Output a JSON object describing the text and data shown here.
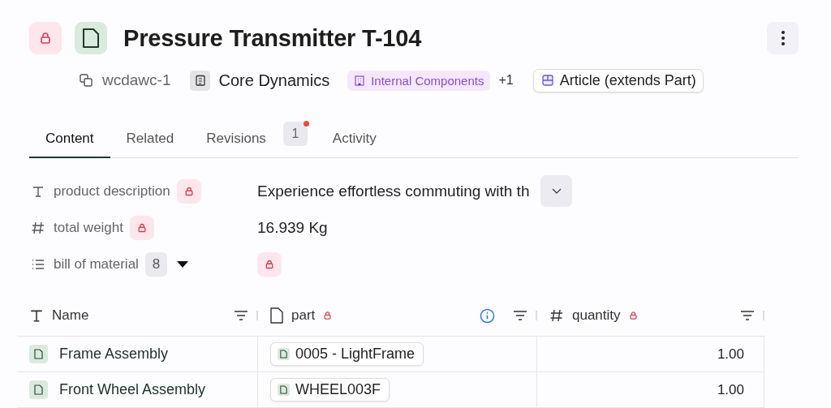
{
  "header": {
    "title": "Pressure Transmitter T-104"
  },
  "meta": {
    "id": "wcdawc-1",
    "company": "Core Dynamics",
    "tag": "Internal Components",
    "more": "+1",
    "type": "Article (extends Part)"
  },
  "tabs": [
    {
      "label": "Content",
      "selected": true
    },
    {
      "label": "Related",
      "selected": false
    },
    {
      "label": "Revisions",
      "selected": false,
      "count": "1",
      "unread": true
    },
    {
      "label": "Activity",
      "selected": false
    }
  ],
  "fields": [
    {
      "kind": "text",
      "label": "product description",
      "locked": true,
      "value": "Experience effortless commuting with th"
    },
    {
      "kind": "number",
      "label": "total weight",
      "locked": true,
      "value": "16.939 Kg"
    },
    {
      "kind": "list",
      "label": "bill of material",
      "count": "8",
      "locked": true
    }
  ],
  "table": {
    "columns": [
      {
        "kind": "text",
        "label": "Name",
        "locked": false,
        "info": false
      },
      {
        "kind": "doc",
        "label": "part",
        "locked": true,
        "info": true
      },
      {
        "kind": "number",
        "label": "quantity",
        "locked": true,
        "info": false
      }
    ],
    "rows": [
      {
        "name": "Frame Assembly",
        "part": "0005 - LightFrame",
        "quantity": "1.00"
      },
      {
        "name": "Front Wheel Assembly",
        "part": "WHEEL003F",
        "quantity": "1.00"
      }
    ]
  }
}
